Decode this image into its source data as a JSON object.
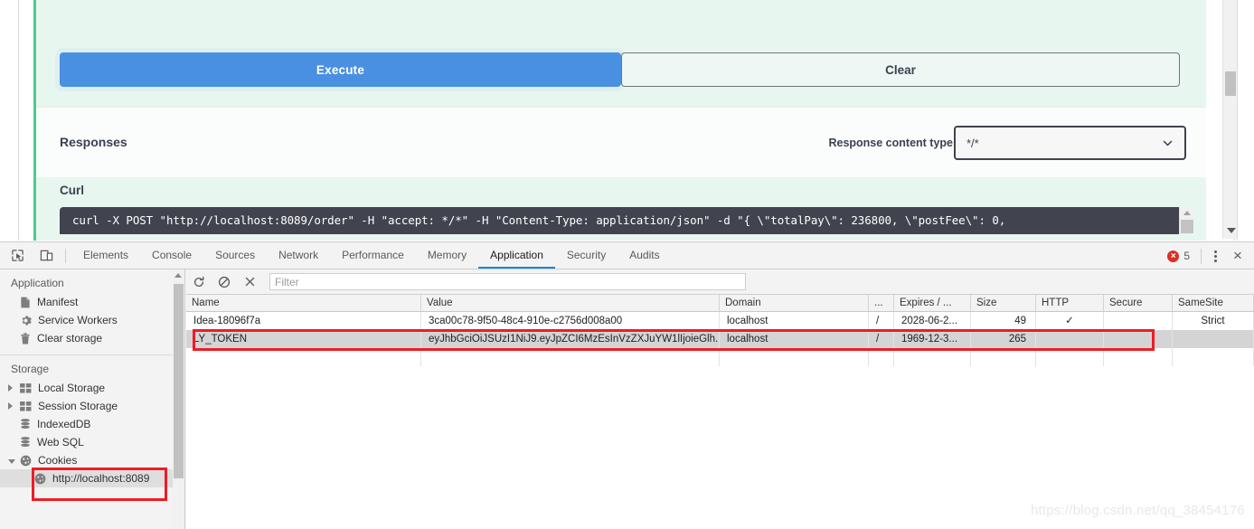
{
  "swagger": {
    "execute_label": "Execute",
    "clear_label": "Clear",
    "responses_title": "Responses",
    "response_content_type_label": "Response content type",
    "response_content_type_value": "*/*",
    "curl_title": "Curl",
    "curl_command": "curl -X POST \"http://localhost:8089/order\" -H \"accept: */*\" -H \"Content-Type: application/json\" -d \"{ \\\"totalPay\\\": 236800, \\\"postFee\\\": 0,",
    "accent_color": "#49cc90",
    "execute_color": "#4990e2"
  },
  "devtools": {
    "tabs": [
      {
        "label": "Elements",
        "active": false
      },
      {
        "label": "Console",
        "active": false
      },
      {
        "label": "Sources",
        "active": false
      },
      {
        "label": "Network",
        "active": false
      },
      {
        "label": "Performance",
        "active": false
      },
      {
        "label": "Memory",
        "active": false
      },
      {
        "label": "Application",
        "active": true
      },
      {
        "label": "Security",
        "active": false
      },
      {
        "label": "Audits",
        "active": false
      }
    ],
    "error_count": "5",
    "error_color": "#d93025",
    "active_tab_underline_color": "#1a86d6",
    "filter_placeholder": "Filter",
    "sidebar": {
      "application_title": "Application",
      "application_items": [
        {
          "label": "Manifest",
          "icon": "document-icon"
        },
        {
          "label": "Service Workers",
          "icon": "gear-icon"
        },
        {
          "label": "Clear storage",
          "icon": "trash-icon"
        }
      ],
      "storage_title": "Storage",
      "storage_items": [
        {
          "label": "Local Storage",
          "icon": "grid-icon",
          "expandable": true,
          "expanded": false,
          "selected": false
        },
        {
          "label": "Session Storage",
          "icon": "grid-icon",
          "expandable": true,
          "expanded": false,
          "selected": false
        },
        {
          "label": "IndexedDB",
          "icon": "database-icon",
          "expandable": false,
          "expanded": false,
          "selected": false
        },
        {
          "label": "Web SQL",
          "icon": "database-icon",
          "expandable": false,
          "expanded": false,
          "selected": false
        },
        {
          "label": "Cookies",
          "icon": "cookie-icon",
          "expandable": true,
          "expanded": true,
          "selected": false
        }
      ],
      "cookie_origin": {
        "label": "http://localhost:8089",
        "icon": "cookie-icon",
        "selected": true
      }
    },
    "cookies_table": {
      "columns": [
        "Name",
        "Value",
        "Domain",
        "...",
        "Expires / ...",
        "Size",
        "HTTP",
        "Secure",
        "SameSite"
      ],
      "rows": [
        {
          "name": "Idea-18096f7a",
          "value": "3ca00c78-9f50-48c4-910e-c2756d008a00",
          "domain": "localhost",
          "path": "/",
          "expires": "2028-06-2...",
          "size": "49",
          "http": "✓",
          "secure": "",
          "samesite": "Strict",
          "selected": false
        },
        {
          "name": "LY_TOKEN",
          "value": "eyJhbGciOiJSUzI1NiJ9.eyJpZCI6MzEsInVzZXJuYW1lIjoieGlh...",
          "domain": "localhost",
          "path": "/",
          "expires": "1969-12-3...",
          "size": "265",
          "http": "",
          "secure": "",
          "samesite": "",
          "selected": true
        }
      ]
    }
  },
  "annotations": {
    "highlight_color": "#ee1c25"
  },
  "watermark": "https://blog.csdn.net/qq_38454176"
}
